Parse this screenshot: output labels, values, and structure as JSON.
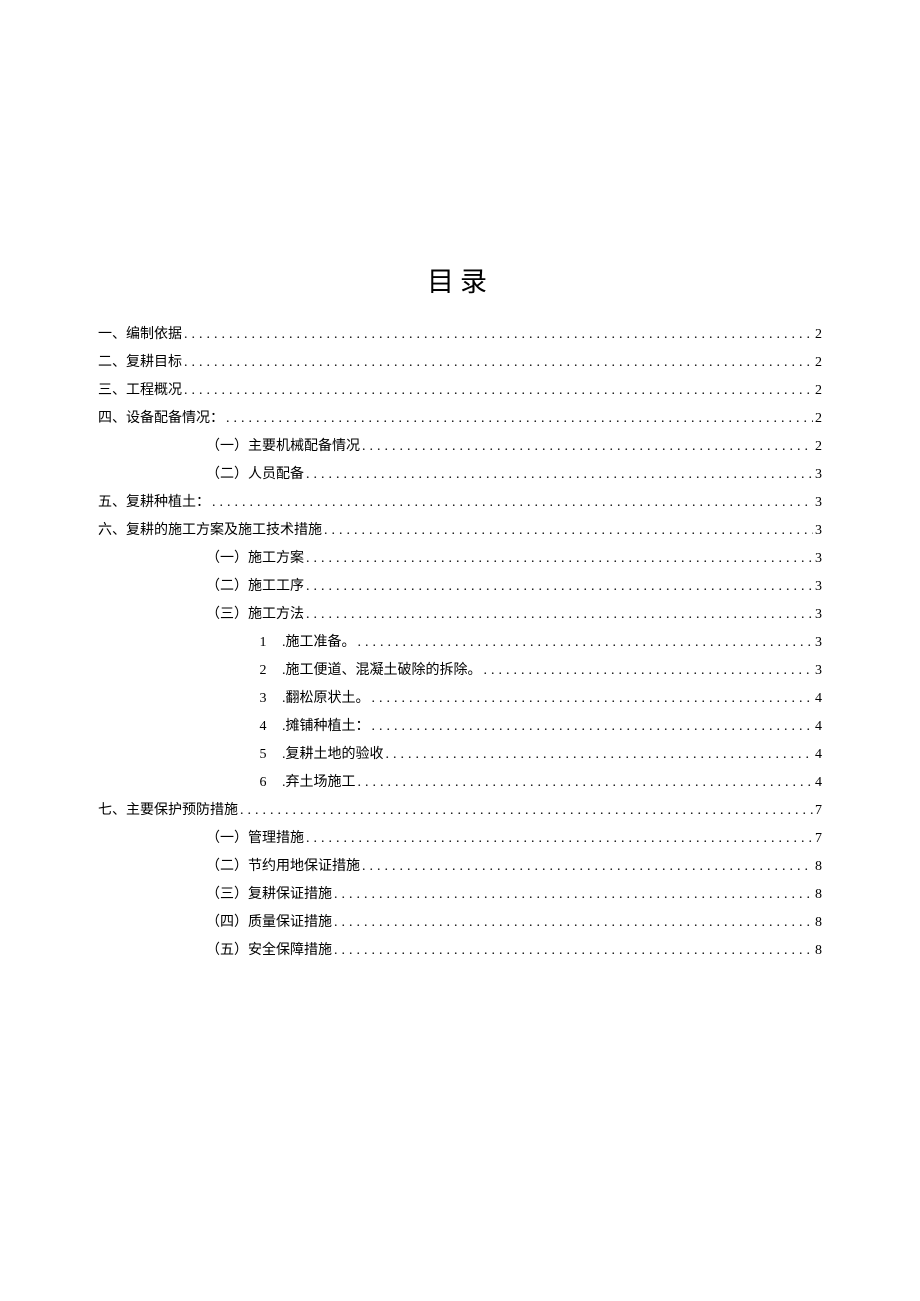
{
  "title": "目录",
  "toc": [
    {
      "level": 0,
      "label": "一、编制依据",
      "page": "2"
    },
    {
      "level": 0,
      "label": "二、复耕目标",
      "page": "2"
    },
    {
      "level": 0,
      "label": "三、工程概况",
      "page": "2"
    },
    {
      "level": 0,
      "label": "四、设备配备情况：",
      "page": "2"
    },
    {
      "level": 1,
      "label": "（一）主要机械配备情况",
      "page": "2"
    },
    {
      "level": 1,
      "label": "（二）人员配备",
      "page": "3"
    },
    {
      "level": 0,
      "label": "五、复耕种植土：",
      "page": "3"
    },
    {
      "level": 0,
      "label": "六、复耕的施工方案及施工技术措施",
      "page": "3"
    },
    {
      "level": 1,
      "label": "（一）施工方案",
      "page": "3"
    },
    {
      "level": 1,
      "label": "（二）施工工序",
      "page": "3"
    },
    {
      "level": 1,
      "label": "（三）施工方法",
      "page": "3"
    },
    {
      "level": 2,
      "num": "1",
      "label": ".施工准备。",
      "page": "3"
    },
    {
      "level": 2,
      "num": "2",
      "label": ".施工便道、混凝土破除的拆除。",
      "page": "3"
    },
    {
      "level": 2,
      "num": "3",
      "label": ".翻松原状土。",
      "page": "4"
    },
    {
      "level": 2,
      "num": "4",
      "label": ".摊铺种植土：",
      "page": "4"
    },
    {
      "level": 2,
      "num": "5",
      "label": ".复耕土地的验收",
      "page": "4"
    },
    {
      "level": 2,
      "num": "6",
      "label": ".弃土场施工",
      "page": "4"
    },
    {
      "level": 0,
      "label": "七、主要保护预防措施",
      "page": "7"
    },
    {
      "level": 1,
      "label": "（一）管理措施",
      "page": "7"
    },
    {
      "level": 1,
      "label": "（二）节约用地保证措施",
      "page": "8"
    },
    {
      "level": 1,
      "label": "（三）复耕保证措施",
      "page": "8"
    },
    {
      "level": 1,
      "label": "（四）质量保证措施",
      "page": "8"
    },
    {
      "level": 1,
      "label": "（五）安全保障措施",
      "page": "8"
    }
  ]
}
